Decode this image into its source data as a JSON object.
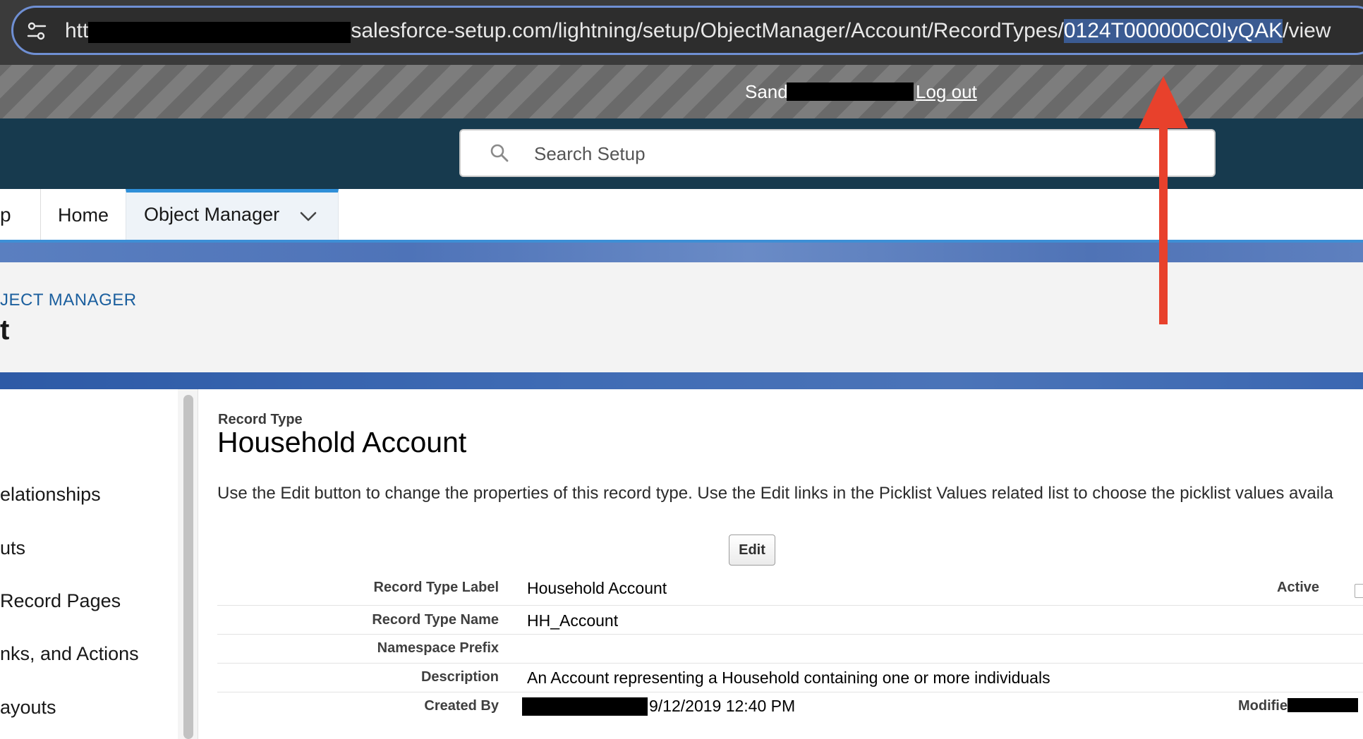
{
  "browser": {
    "url_prefix": "htt",
    "url_domain_path": "salesforce-setup.com/lightning/setup/ObjectManager/Account/RecordTypes/",
    "url_selected_id": "0124T000000C0IyQAK",
    "url_suffix": "/view"
  },
  "banner": {
    "user_prefix": "Sand",
    "logout_label": "Log out"
  },
  "header": {
    "search_placeholder": "Search Setup"
  },
  "nav": {
    "app_fragment": "p",
    "tabs": [
      {
        "label": "Home"
      },
      {
        "label": "Object Manager"
      }
    ]
  },
  "page_header": {
    "breadcrumb": "JECT MANAGER",
    "title_fragment": "t"
  },
  "sidebar": {
    "items": [
      {
        "label": "elationships"
      },
      {
        "label": "uts"
      },
      {
        "label": "Record Pages"
      },
      {
        "label": "nks, and Actions"
      },
      {
        "label": "ayouts"
      }
    ]
  },
  "record": {
    "eyebrow": "Record Type",
    "title": "Household Account",
    "description": "Use the Edit button to change the properties of this record type. Use the Edit links in the Picklist Values related list to choose the picklist values availa",
    "edit_label": "Edit",
    "fields": [
      {
        "label": "Record Type Label",
        "value": "Household Account"
      },
      {
        "label": "Record Type Name",
        "value": "HH_Account"
      },
      {
        "label": "Namespace Prefix",
        "value": ""
      },
      {
        "label": "Description",
        "value": "An Account representing a Household containing one or more individuals"
      },
      {
        "label": "Created By",
        "value": "9/12/2019 12:40 PM"
      }
    ],
    "active_label": "Active",
    "modified_label": "Modifie"
  },
  "colors": {
    "annotation_arrow": "#e8412c",
    "header_bg": "#173a4e",
    "link_blue": "#1b5f9e",
    "tab_accent": "#2f8fd8"
  }
}
